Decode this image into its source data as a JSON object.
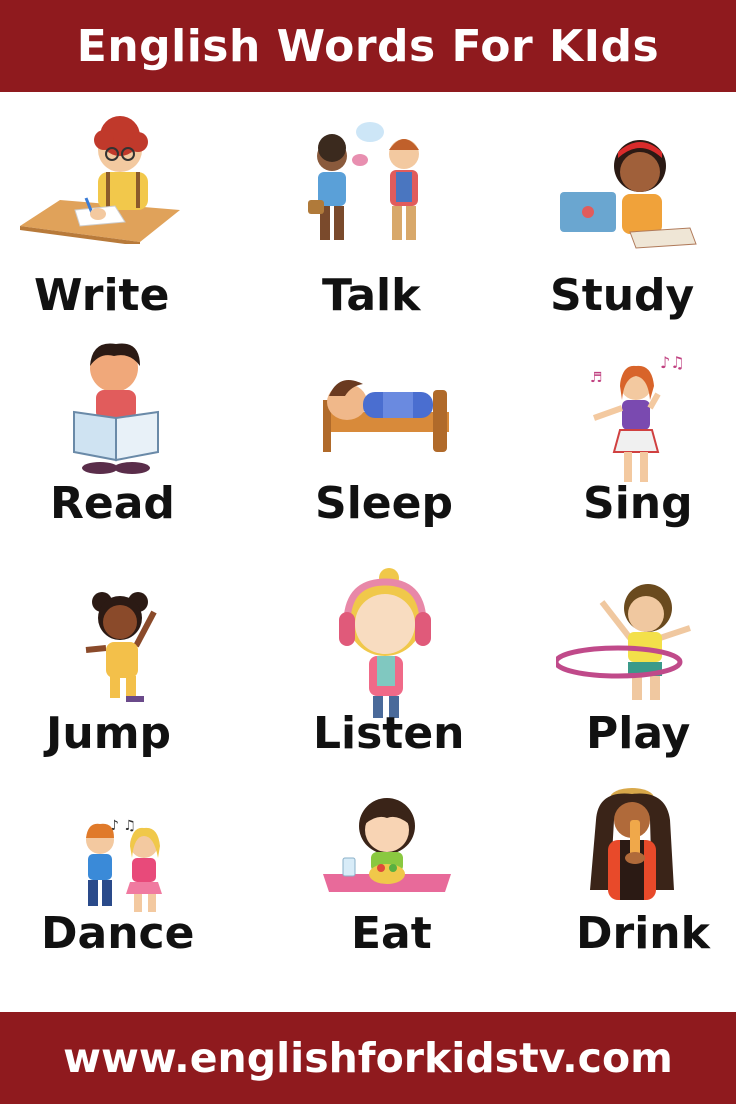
{
  "header": {
    "title": "English Words For KIds"
  },
  "footer": {
    "url": "www.englishforkidstv.com"
  },
  "words": [
    {
      "label": "Write",
      "icon": "writing-child-icon"
    },
    {
      "label": "Talk",
      "icon": "talking-children-icon"
    },
    {
      "label": "Study",
      "icon": "studying-girl-laptop-icon"
    },
    {
      "label": "Read",
      "icon": "reading-boy-icon"
    },
    {
      "label": "Sleep",
      "icon": "sleeping-child-icon"
    },
    {
      "label": "Sing",
      "icon": "singing-girl-icon"
    },
    {
      "label": "Jump",
      "icon": "jumping-girl-icon"
    },
    {
      "label": "Listen",
      "icon": "headphones-girl-icon"
    },
    {
      "label": "Play",
      "icon": "hula-hoop-child-icon"
    },
    {
      "label": "Dance",
      "icon": "dancing-children-icon"
    },
    {
      "label": "Eat",
      "icon": "eating-girl-icon"
    },
    {
      "label": "Drink",
      "icon": "drinking-girl-icon"
    }
  ]
}
